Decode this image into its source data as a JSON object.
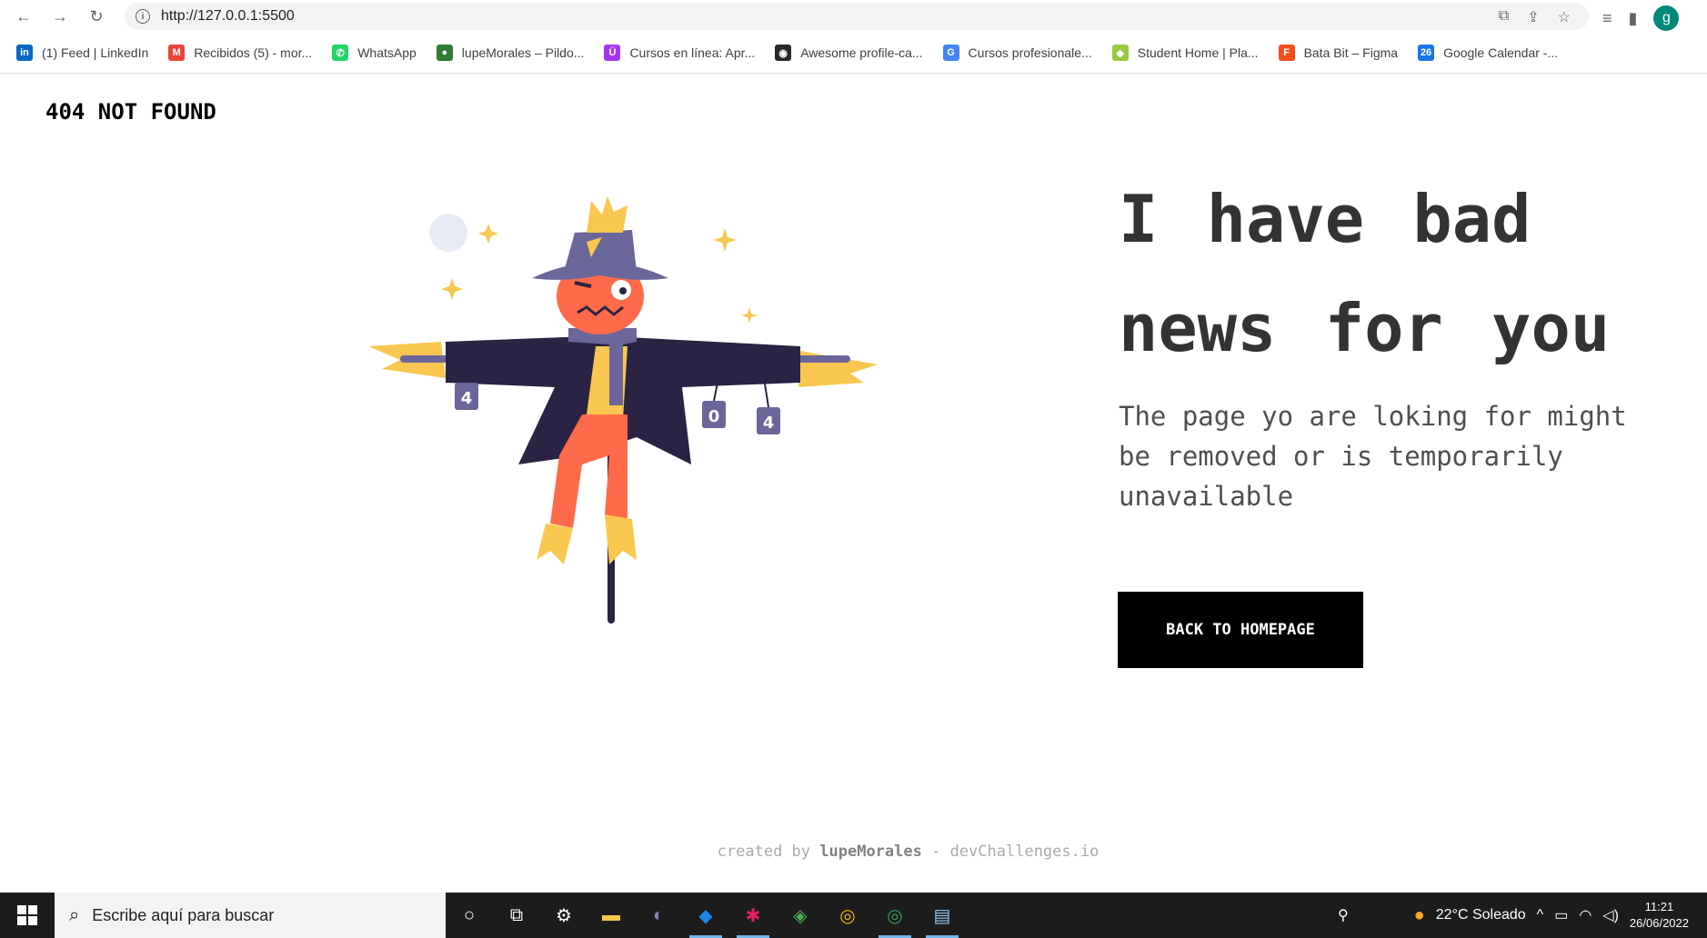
{
  "browser": {
    "url": "http://127.0.0.1:5500",
    "profile_initial": "g",
    "bookmarks": [
      {
        "label": "(1) Feed | LinkedIn",
        "icon": "linkedin-icon",
        "color": "#0a66c2",
        "glyph": "in"
      },
      {
        "label": "Recibidos (5) - mor...",
        "icon": "gmail-icon",
        "color": "#ea4335",
        "glyph": "M"
      },
      {
        "label": "WhatsApp",
        "icon": "whatsapp-icon",
        "color": "#25d366",
        "glyph": "✆"
      },
      {
        "label": "lupeMorales – Pildo...",
        "icon": "pildo-icon",
        "color": "#2e7d32",
        "glyph": "●"
      },
      {
        "label": "Cursos en línea: Apr...",
        "icon": "udemy-icon",
        "color": "#a435f0",
        "glyph": "Ü"
      },
      {
        "label": "Awesome profile-ca...",
        "icon": "github-icon",
        "color": "#24292e",
        "glyph": "◉"
      },
      {
        "label": "Cursos profesionale...",
        "icon": "google-icon",
        "color": "#4285f4",
        "glyph": "G"
      },
      {
        "label": "Student Home | Pla...",
        "icon": "platzi-icon",
        "color": "#98ca3f",
        "glyph": "◆"
      },
      {
        "label": "Bata Bit – Figma",
        "icon": "figma-icon",
        "color": "#f24e1e",
        "glyph": "F"
      },
      {
        "label": "Google Calendar -...",
        "icon": "calendar-icon",
        "color": "#1a73e8",
        "glyph": "26"
      }
    ]
  },
  "page": {
    "logo": "404 NOT FOUND",
    "headline": "I have bad news for you",
    "subtitle": "The page yo are loking for might be removed or is temporarily unavailable",
    "cta": "BACK TO HOMEPAGE",
    "footer_prefix": "created by",
    "footer_author": "lupeMorales",
    "footer_suffix": "- devChallenges.io",
    "illustration_letters": [
      "4",
      "0",
      "4"
    ]
  },
  "taskbar": {
    "search_placeholder": "Escribe aquí para buscar",
    "weather": "22°C  Soleado",
    "time": "11:21",
    "date": "26/06/2022"
  }
}
